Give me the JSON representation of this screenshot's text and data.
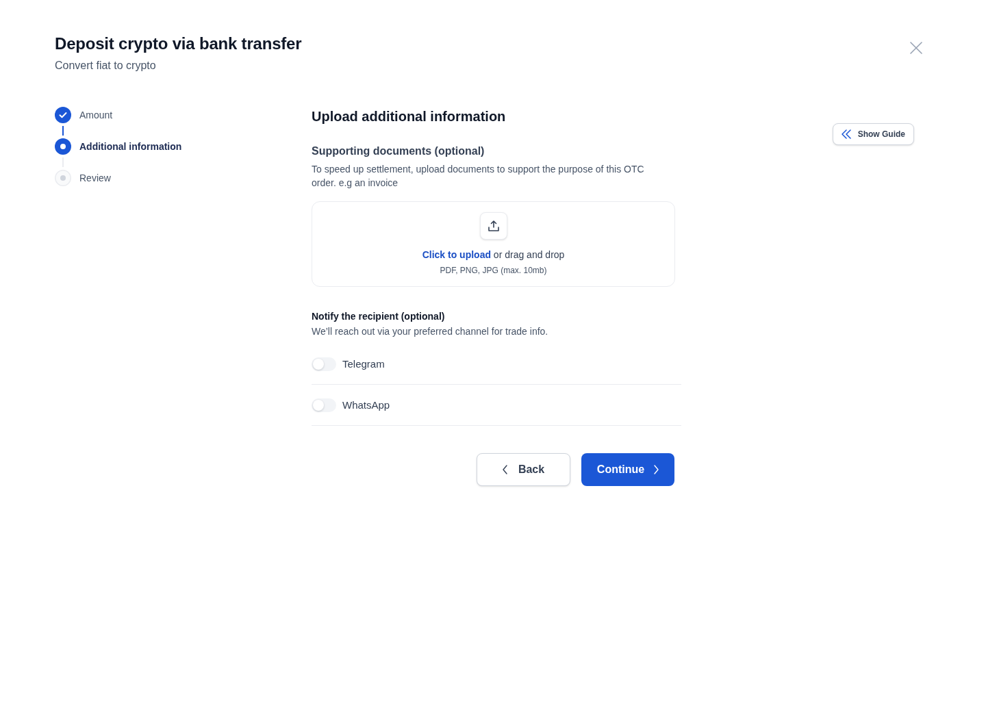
{
  "header": {
    "title": "Deposit crypto via bank transfer",
    "subtitle": "Convert fiat to crypto"
  },
  "steps": [
    {
      "label": "Amount",
      "completed": true,
      "selected": false
    },
    {
      "label": "Additional information",
      "completed": false,
      "selected": true
    },
    {
      "label": "Review",
      "completed": false,
      "selected": false
    }
  ],
  "section": {
    "title": "Upload additional information"
  },
  "documents": {
    "title": "Supporting documents (optional)",
    "description": "To speed up settlement, upload documents to support the purpose of this OTC order. e.g an invoice",
    "upload": {
      "link": "Click to upload",
      "text": "or drag and drop",
      "hint": "PDF, PNG, JPG (max. 10mb)"
    }
  },
  "notify": {
    "title": "Notify the recipient (optional)",
    "description": "We’ll reach out via your preferred channel for trade info.",
    "channels": [
      {
        "label": "Telegram",
        "on": false
      },
      {
        "label": "WhatsApp",
        "on": false
      }
    ]
  },
  "actions": [
    {
      "label": "Back",
      "kind": "secondary"
    },
    {
      "label": "Continue",
      "kind": "primary"
    }
  ],
  "guide_button": {
    "label": "Show Guide"
  }
}
